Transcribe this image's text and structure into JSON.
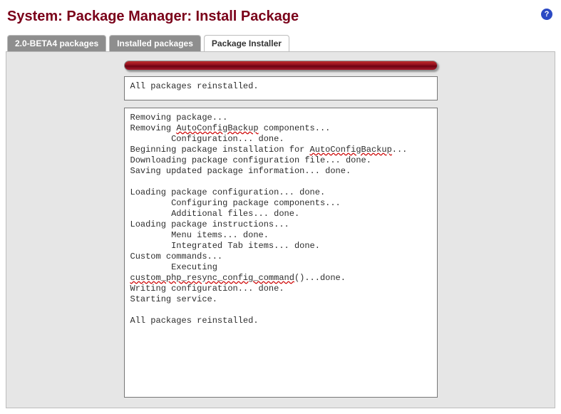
{
  "header": {
    "title": "System: Package Manager: Install Package",
    "help_icon_glyph": "?"
  },
  "tabs": {
    "items": [
      {
        "label": "2.0-BETA4 packages",
        "active": false
      },
      {
        "label": "Installed packages",
        "active": false
      },
      {
        "label": "Package Installer",
        "active": true
      }
    ]
  },
  "status": {
    "text": "All packages reinstalled."
  },
  "log": {
    "lines": [
      {
        "segments": [
          {
            "t": "Removing package..."
          }
        ]
      },
      {
        "segments": [
          {
            "t": "Removing "
          },
          {
            "t": "AutoConfigBackup",
            "u": true
          },
          {
            "t": " components..."
          }
        ]
      },
      {
        "segments": [
          {
            "t": "        Configuration... done."
          }
        ]
      },
      {
        "segments": [
          {
            "t": "Beginning package installation for "
          },
          {
            "t": "AutoConfigBackup",
            "u": true
          },
          {
            "t": "..."
          }
        ]
      },
      {
        "segments": [
          {
            "t": "Downloading package configuration file... done."
          }
        ]
      },
      {
        "segments": [
          {
            "t": "Saving updated package information... done."
          }
        ]
      },
      {
        "segments": [
          {
            "t": ""
          }
        ]
      },
      {
        "segments": [
          {
            "t": "Loading package configuration... done."
          }
        ]
      },
      {
        "segments": [
          {
            "t": "        Configuring package components..."
          }
        ]
      },
      {
        "segments": [
          {
            "t": "        Additional files... done."
          }
        ]
      },
      {
        "segments": [
          {
            "t": "Loading package instructions..."
          }
        ]
      },
      {
        "segments": [
          {
            "t": "        Menu items... done."
          }
        ]
      },
      {
        "segments": [
          {
            "t": "        Integrated Tab items... done."
          }
        ]
      },
      {
        "segments": [
          {
            "t": "Custom commands..."
          }
        ]
      },
      {
        "segments": [
          {
            "t": "        Executing "
          },
          {
            "t": "custom_php_resync_config_command",
            "u": true
          },
          {
            "t": "()...done."
          }
        ]
      },
      {
        "segments": [
          {
            "t": "Writing configuration... done."
          }
        ]
      },
      {
        "segments": [
          {
            "t": "Starting service."
          }
        ]
      },
      {
        "segments": [
          {
            "t": ""
          }
        ]
      },
      {
        "segments": [
          {
            "t": "All packages reinstalled."
          }
        ]
      }
    ]
  }
}
